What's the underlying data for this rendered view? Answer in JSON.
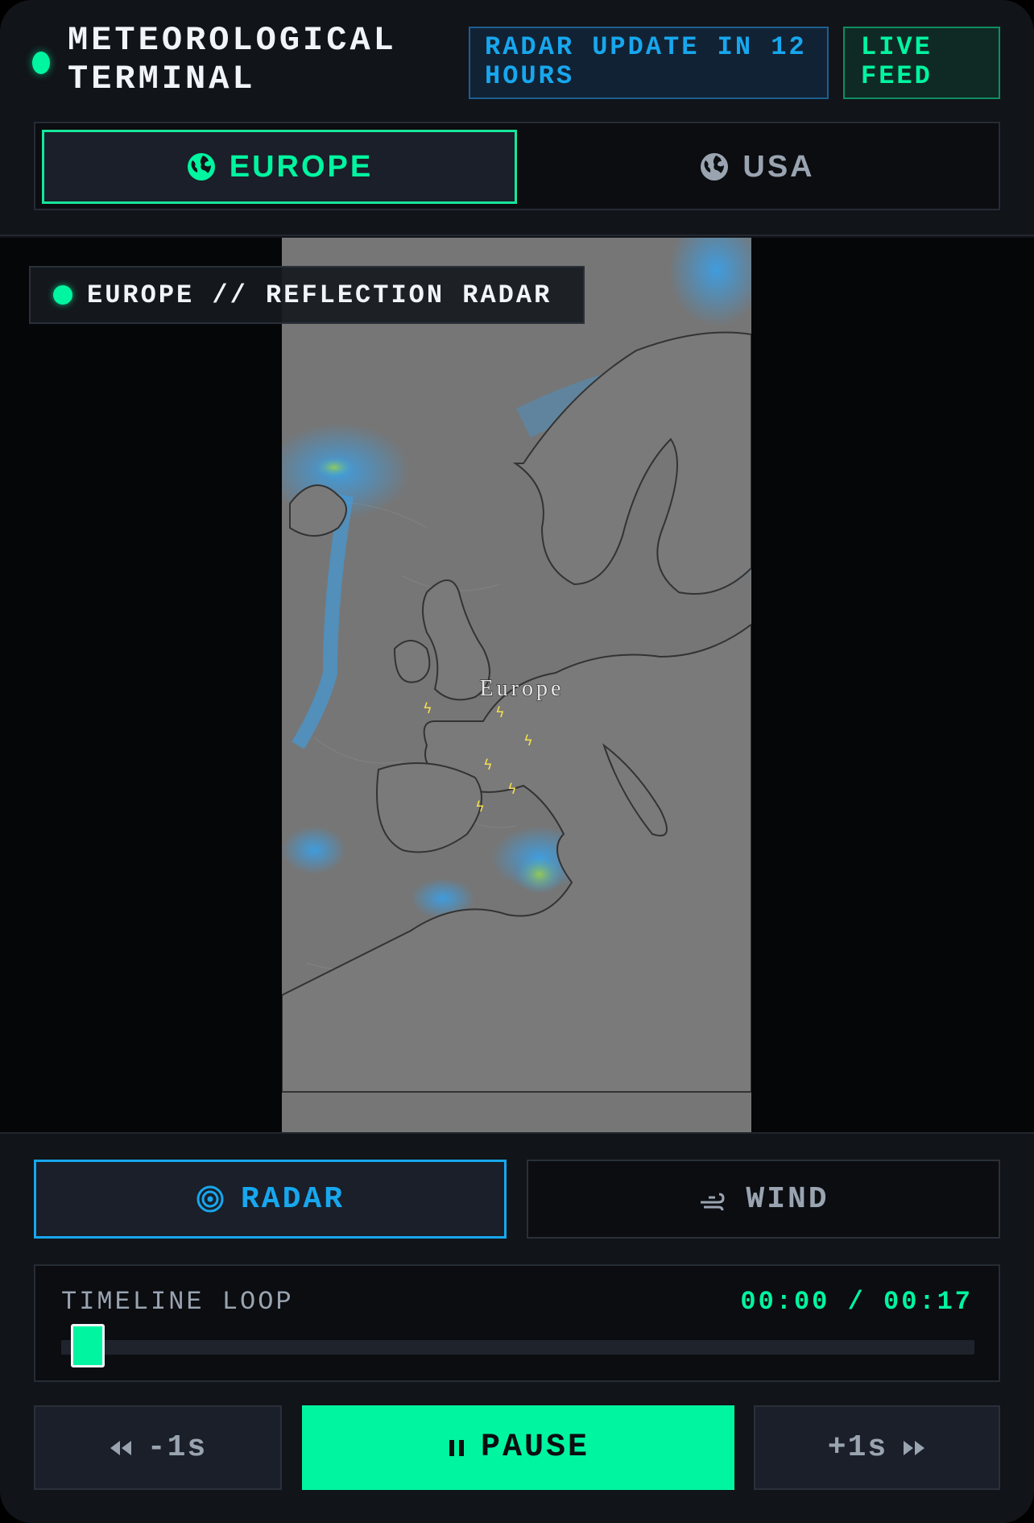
{
  "header": {
    "title": "METEOROLOGICAL TERMINAL",
    "radar_badge": "RADAR UPDATE IN 12 HOURS",
    "live_badge": "LIVE FEED"
  },
  "region_tabs": [
    {
      "label": "EUROPE",
      "icon": "globe-icon",
      "active": true
    },
    {
      "label": "USA",
      "icon": "globe-icon",
      "active": false
    }
  ],
  "map": {
    "overlay_label": "EUROPE // REFLECTION RADAR",
    "map_text": "Europe"
  },
  "mode_tabs": [
    {
      "label": "RADAR",
      "icon": "radar-icon",
      "active": true
    },
    {
      "label": "WIND",
      "icon": "wind-icon",
      "active": false
    }
  ],
  "timeline": {
    "label": "TIMELINE LOOP",
    "time": "00:00 / 00:17",
    "progress": 0
  },
  "playback": {
    "back_label": "-1s",
    "pause_label": "PAUSE",
    "forward_label": "+1s"
  },
  "colors": {
    "accent_green": "#00f5a0",
    "accent_blue": "#17a7ee",
    "background": "#111419"
  }
}
